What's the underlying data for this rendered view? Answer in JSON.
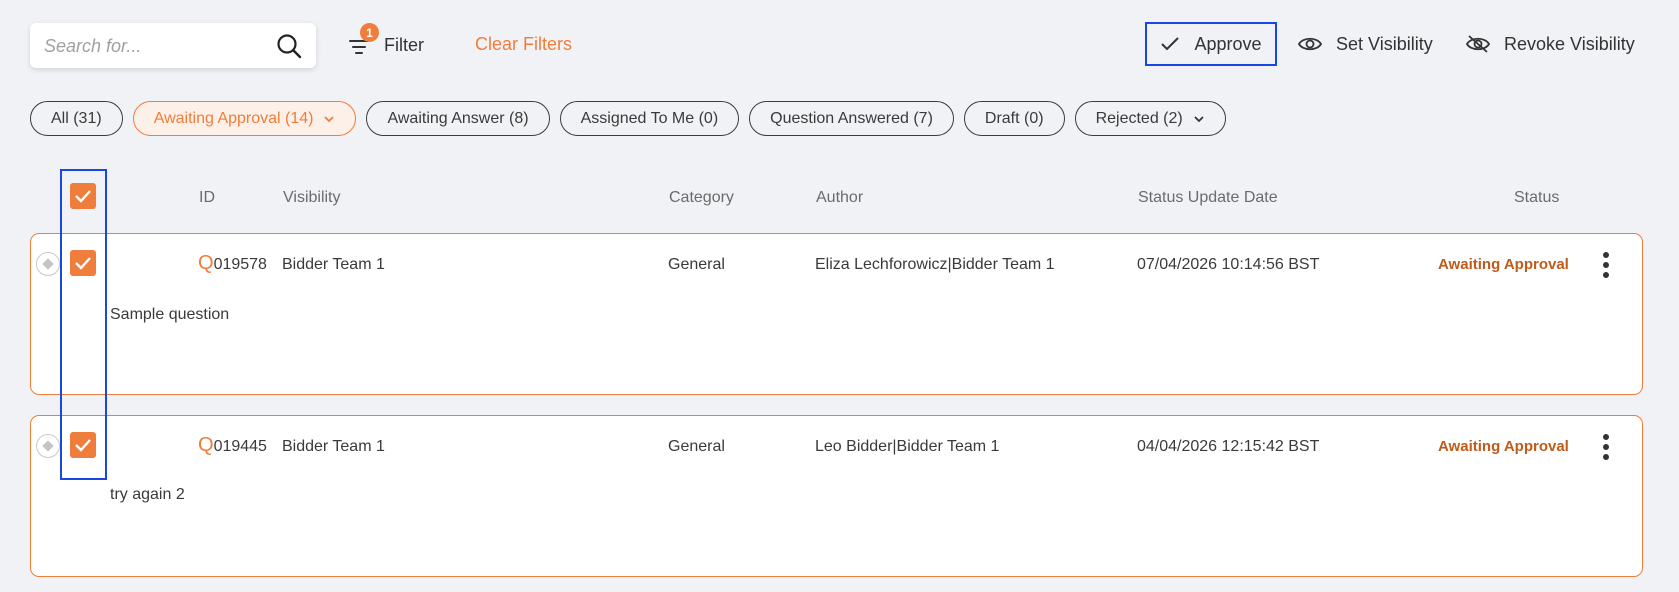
{
  "search": {
    "placeholder": "Search for..."
  },
  "filter": {
    "label": "Filter",
    "badge_count": "1"
  },
  "clear_filters": "Clear Filters",
  "actions": {
    "approve": "Approve",
    "set_visibility": "Set Visibility",
    "revoke_visibility": "Revoke Visibility"
  },
  "tabs": [
    {
      "label": "All (31)"
    },
    {
      "label": "Awaiting Approval (14)"
    },
    {
      "label": "Awaiting Answer (8)"
    },
    {
      "label": "Assigned To Me (0)"
    },
    {
      "label": "Question Answered (7)"
    },
    {
      "label": "Draft (0)"
    },
    {
      "label": "Rejected (2)"
    }
  ],
  "columns": {
    "id": "ID",
    "visibility": "Visibility",
    "category": "Category",
    "author": "Author",
    "status_update_date": "Status Update Date",
    "status": "Status"
  },
  "rows": [
    {
      "id_prefix": "Q",
      "id_number": "019578",
      "visibility": "Bidder Team 1",
      "category": "General",
      "author": "Eliza Lechforowicz|Bidder Team 1",
      "date": "07/04/2026 10:14:56 BST",
      "status": "Awaiting Approval",
      "question": "Sample question"
    },
    {
      "id_prefix": "Q",
      "id_number": "019445",
      "visibility": "Bidder Team 1",
      "category": "General",
      "author": "Leo Bidder|Bidder Team 1",
      "date": "04/04/2026 12:15:42 BST",
      "status": "Awaiting Approval",
      "question": "try again 2"
    }
  ],
  "colors": {
    "accent": "#ef7d3c",
    "highlight": "#1947e5",
    "status_text": "#c05b1a"
  }
}
